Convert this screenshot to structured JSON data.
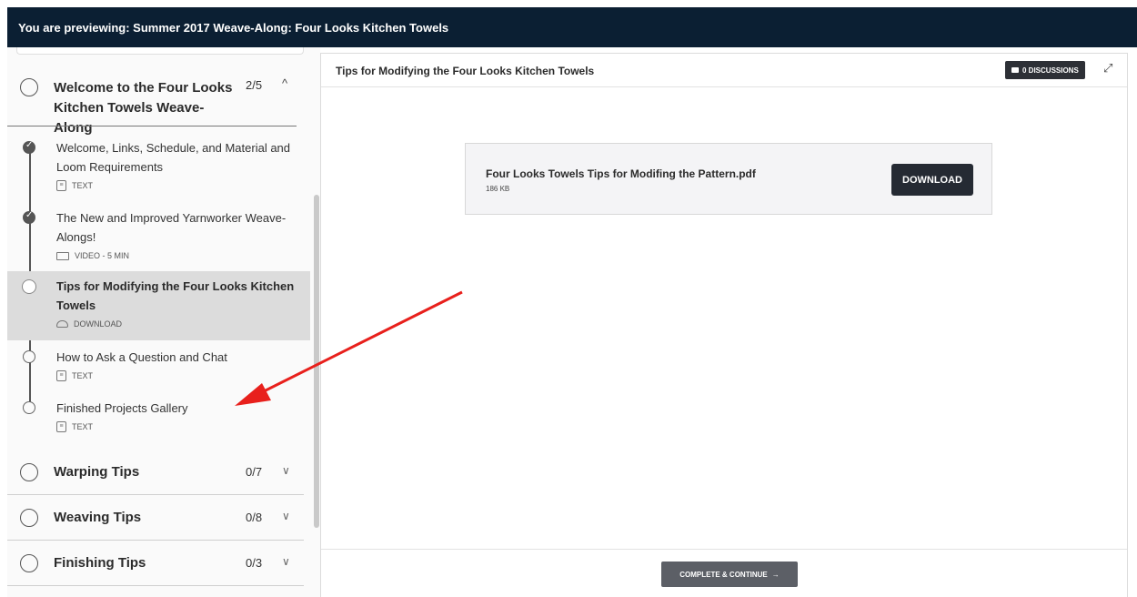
{
  "preview_bar": {
    "text": "You are previewing: Summer 2017 Weave-Along: Four Looks Kitchen Towels"
  },
  "sidebar": {
    "open_section": {
      "title": "Welcome to the Four Looks Kitchen Towels Weave-Along",
      "count": "2/5",
      "chevron": "^",
      "lessons": [
        {
          "title": "Welcome, Links, Schedule, and Material and Loom Requirements",
          "type": "TEXT",
          "status": "complete",
          "icon": "text-doc-icon"
        },
        {
          "title": "The New and Improved Yarnworker Weave-Alongs!",
          "type": "VIDEO - 5 MIN",
          "status": "complete",
          "icon": "video-icon"
        },
        {
          "title": "Tips for Modifying the Four Looks Kitchen Towels",
          "type": "DOWNLOAD",
          "status": "active",
          "icon": "cloud-download-icon"
        },
        {
          "title": "How to Ask a Question and Chat",
          "type": "TEXT",
          "status": "incomplete",
          "icon": "text-doc-icon"
        },
        {
          "title": "Finished Projects Gallery",
          "type": "TEXT",
          "status": "incomplete",
          "icon": "text-doc-icon"
        }
      ]
    },
    "sections": [
      {
        "title": "Warping Tips",
        "count": "0/7"
      },
      {
        "title": "Weaving Tips",
        "count": "0/8"
      },
      {
        "title": "Finishing Tips",
        "count": "0/3"
      }
    ]
  },
  "main": {
    "title": "Tips for Modifying the Four Looks Kitchen Towels",
    "discussions_label": "0 DISCUSSIONS",
    "download": {
      "filename": "Four Looks Towels Tips for Modifing the Pattern.pdf",
      "size": "186 KB",
      "button_label": "DOWNLOAD"
    },
    "continue_label": "COMPLETE & CONTINUE",
    "continue_arrow": "→"
  },
  "icons": {
    "expand": "expand-icon",
    "discussions": "chat-icon",
    "annotation": "red-arrow"
  },
  "colors": {
    "top_bar": "#0b1f33",
    "active_lesson": "#dcdcdc",
    "button_dark": "#252a33",
    "annotation_arrow": "#e8201c"
  }
}
